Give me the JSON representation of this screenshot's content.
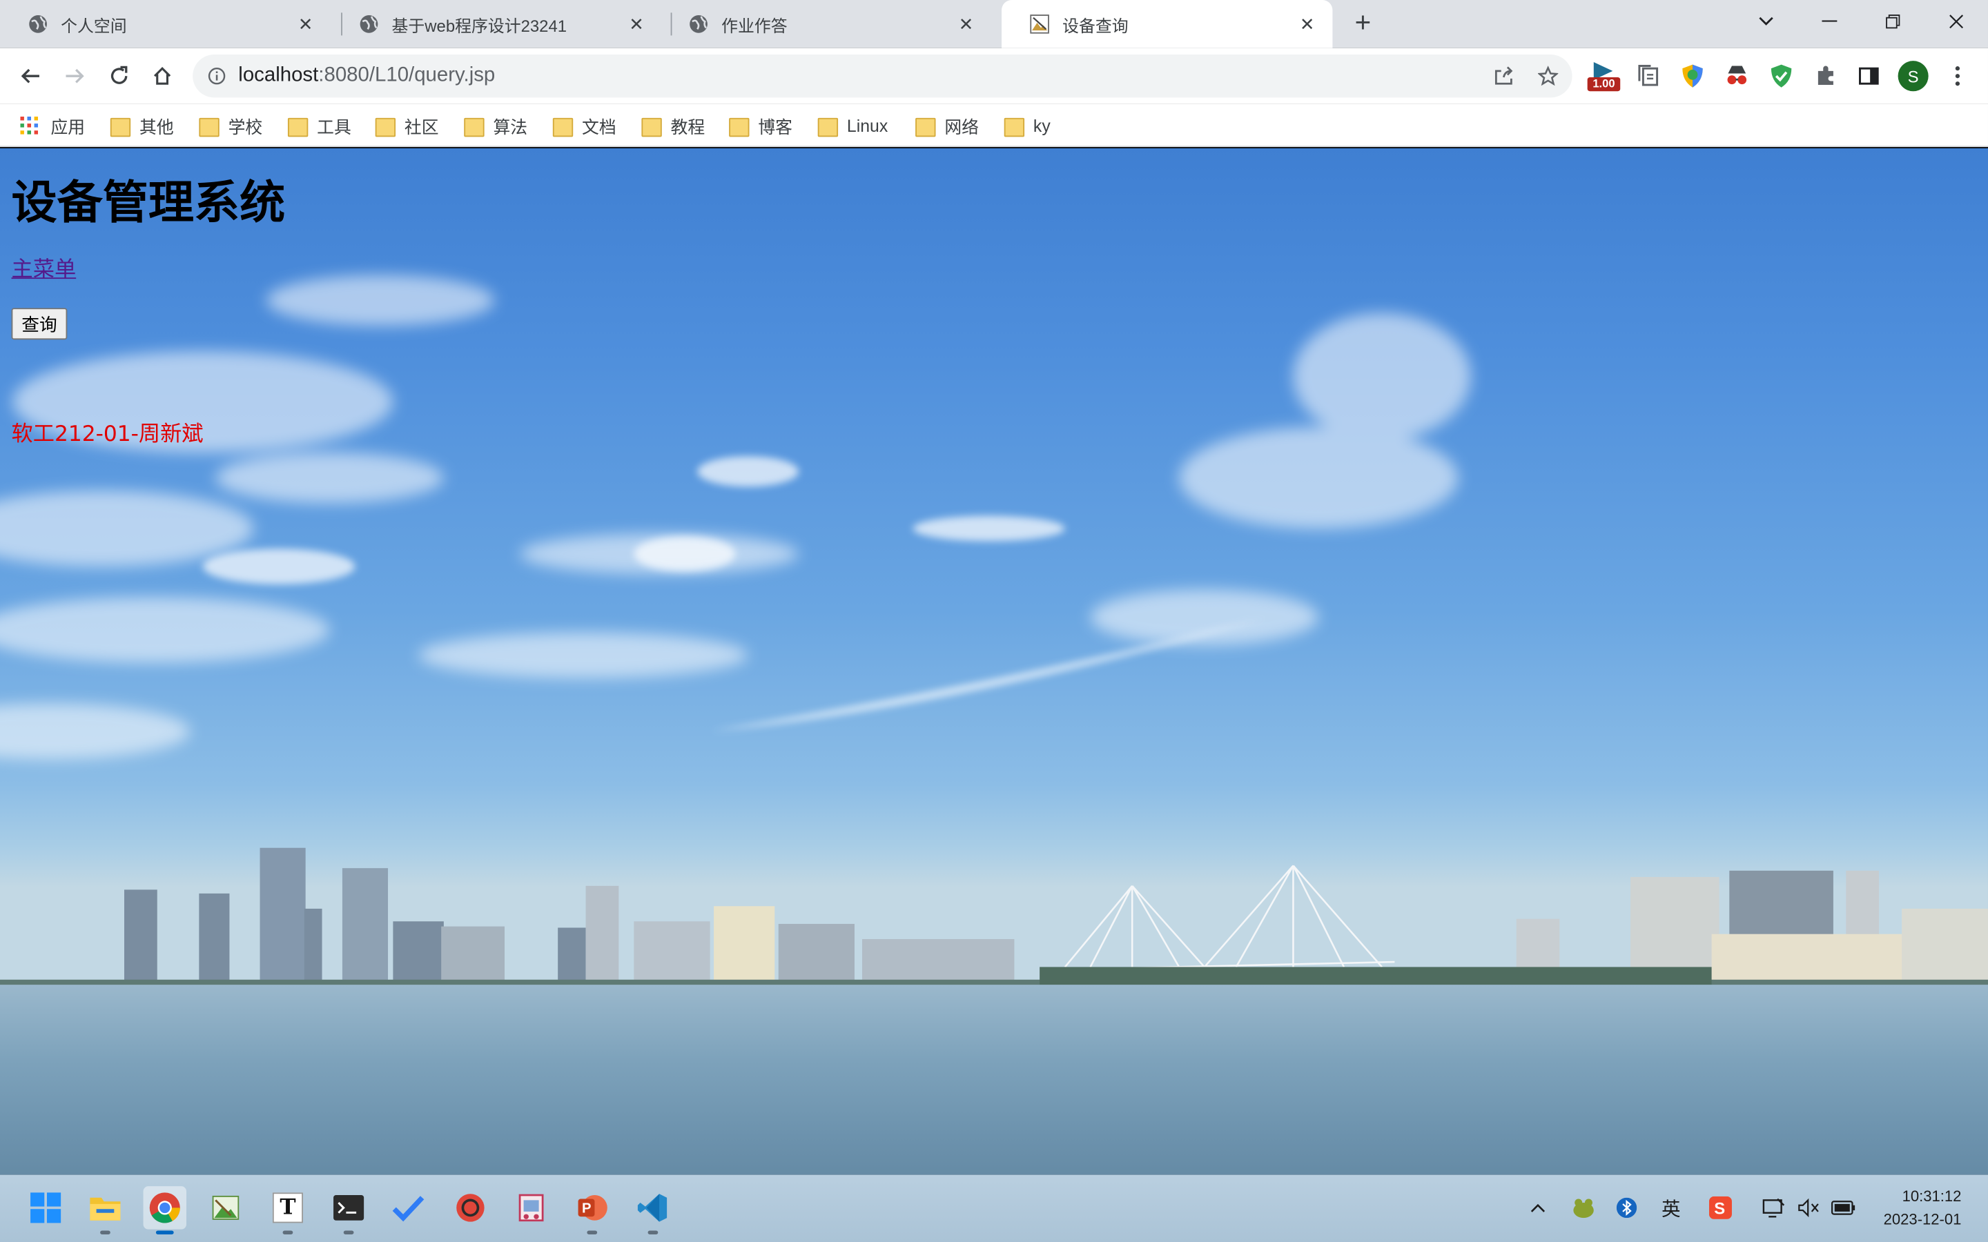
{
  "browser": {
    "tabs": [
      {
        "title": "个人空间",
        "favicon": "globe-icon",
        "active": false
      },
      {
        "title": "基于web程序设计23241",
        "favicon": "globe-icon",
        "active": false
      },
      {
        "title": "作业作答",
        "favicon": "globe-icon",
        "active": false
      },
      {
        "title": "设备查询",
        "favicon": "page-image-icon",
        "active": true
      }
    ],
    "address": {
      "host": "localhost",
      "path": ":8080/L10/query.jsp"
    },
    "extension_badge": "1.00",
    "profile_initial": "S",
    "bookmarks": [
      "应用",
      "其他",
      "学校",
      "工具",
      "社区",
      "算法",
      "文档",
      "教程",
      "博客",
      "Linux",
      "网络",
      "ky"
    ]
  },
  "page": {
    "title": "设备管理系统",
    "menu_link": "主菜单",
    "query_button": "查询",
    "author": "软工212-01-周新斌"
  },
  "taskbar": {
    "ime": "英",
    "time": "10:31:12",
    "date": "2023-12-01"
  },
  "colors": {
    "tabstrip": "#dee1e6",
    "link": "#551a8b",
    "author_text": "#e00000",
    "accent": "#1a73e8"
  }
}
